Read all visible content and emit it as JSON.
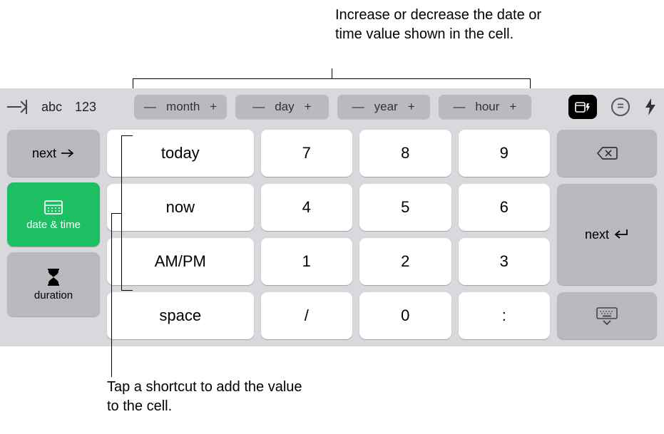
{
  "annotation": {
    "top": "Increase or decrease the date or time value shown in the cell.",
    "bottom": "Tap a shortcut to add the value to the cell."
  },
  "toolbar": {
    "abc": "abc",
    "nums": "123",
    "steppers": [
      "month",
      "day",
      "year",
      "hour"
    ]
  },
  "left_column": {
    "next": "next",
    "date_time": "date & time",
    "duration": "duration"
  },
  "shortcut_keys": [
    "today",
    "now",
    "AM/PM",
    "space"
  ],
  "numpad": [
    [
      "7",
      "8",
      "9"
    ],
    [
      "4",
      "5",
      "6"
    ],
    [
      "1",
      "2",
      "3"
    ],
    [
      "/",
      "0",
      ":"
    ]
  ],
  "right_column": {
    "next": "next"
  },
  "icons": {
    "minus": "—",
    "plus": "+",
    "equal": "="
  }
}
